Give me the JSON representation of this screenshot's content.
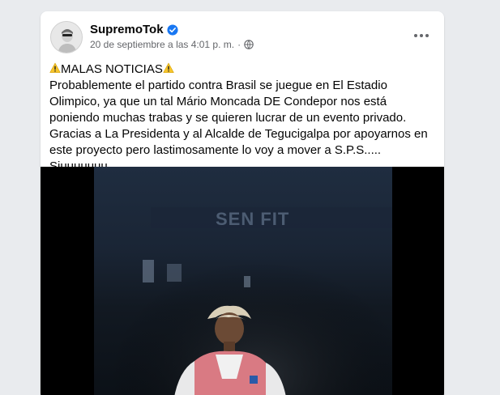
{
  "post": {
    "author": "SupremoTok",
    "timestamp": "20 de septiembre a las 4:01 p. m.",
    "separator": "·",
    "heading": "MALAS NOTICIAS",
    "body": "Probablemente el partido contra Brasil se juegue en El Estadio Olimpico, ya que un tal Mário Moncada DE Condepor nos está poniendo muchas trabas y se quieren lucrar de un evento privado. Gracias a La Presidenta y al Alcalde de Tegucigalpa por apoyarnos en este proyecto pero lastimosamente lo voy a mover a S.P.S..... Siuuuuuuu",
    "media_icon": "photo",
    "banner_text": "SEN FIT"
  },
  "icons": {
    "verified": "verified-badge-icon",
    "privacy": "globe-icon",
    "more": "more-options-icon",
    "warning": "warning-icon"
  },
  "colors": {
    "verified": "#1877f2",
    "text": "#050505",
    "secondary": "#65676b",
    "warning": "#f7c52b"
  }
}
